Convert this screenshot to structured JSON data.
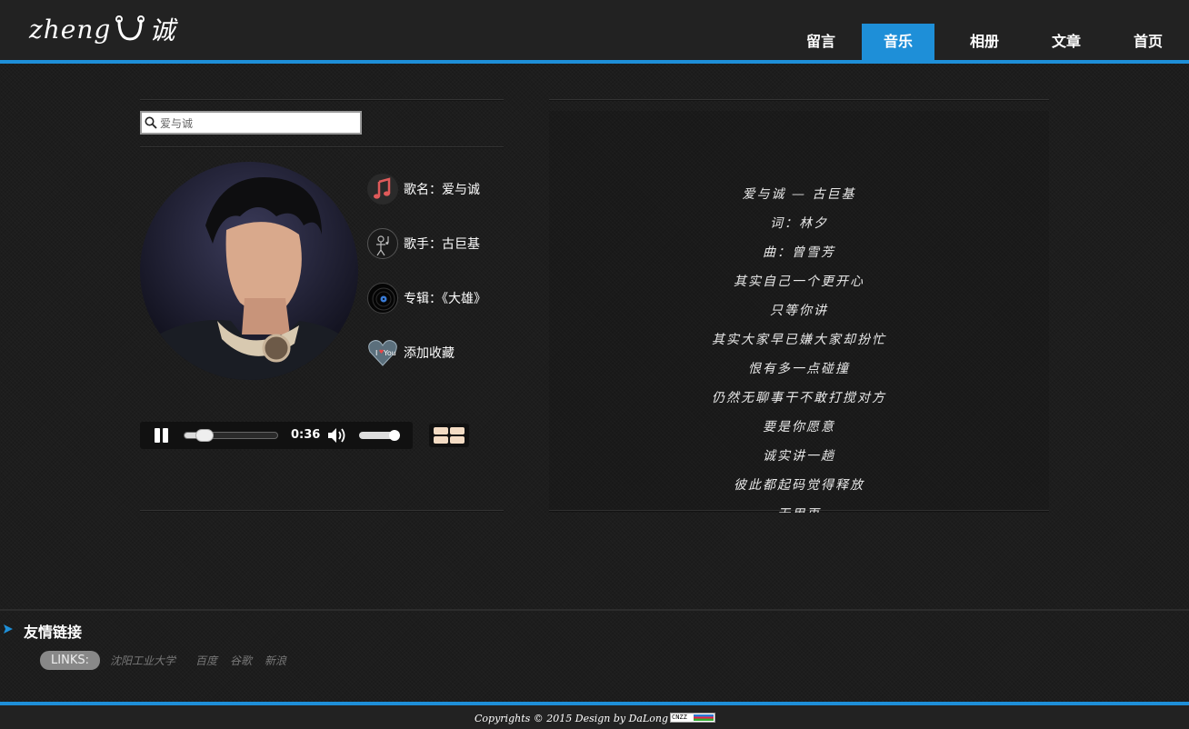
{
  "header": {
    "logo_left": "zheng",
    "logo_right": "诚",
    "nav": [
      {
        "label": "留言",
        "active": false
      },
      {
        "label": "音乐",
        "active": true
      },
      {
        "label": "相册",
        "active": false
      },
      {
        "label": "文章",
        "active": false
      },
      {
        "label": "首页",
        "active": false
      }
    ]
  },
  "player_panel": {
    "search_value": "爱与诚",
    "song_label": "歌名：爱与诚",
    "artist_label": "歌手：古巨基",
    "album_label": "专辑：《大雄》",
    "favorite_label": "添加收藏",
    "current_time": "0:36",
    "progress": 0.22,
    "volume": 0.85
  },
  "lyrics": [
    "爱与诚 — 古巨基",
    "词：林夕",
    "曲：曾雪芳",
    "其实自己一个更开心",
    "只等你讲",
    "其实大家早已嫌大家却扮忙",
    "恨有多一点碰撞",
    "仍然无聊事干不敢打搅对方",
    "要是你愿意",
    "诚实讲一趟",
    "彼此都起码觉得释放",
    "无用再"
  ],
  "links": {
    "title": "友情链接",
    "badge": "LINKS:",
    "items": [
      "沈阳工业大学",
      "百度",
      "谷歌",
      "新浪"
    ]
  },
  "footer": {
    "copyright": "Copyrights © 2015 Design by DaLong",
    "badge": "CNZZ"
  },
  "colors": {
    "accent": "#1e8fd8",
    "background": "#1d1d1d"
  }
}
